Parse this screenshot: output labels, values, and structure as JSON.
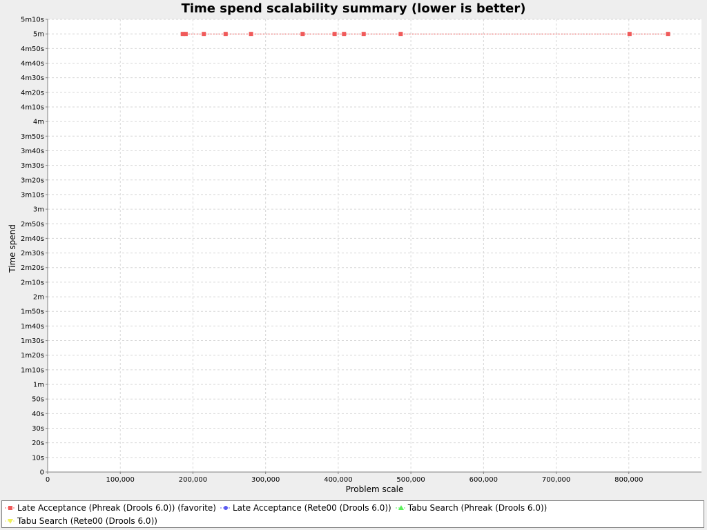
{
  "chart_data": {
    "type": "line",
    "title": "Time spend scalability summary (lower is better)",
    "xlabel": "Problem scale",
    "ylabel": "Time spend",
    "xlim": [
      0,
      900000
    ],
    "ylim": [
      0,
      310
    ],
    "x_ticks": [
      {
        "value": 0,
        "label": "0"
      },
      {
        "value": 100000,
        "label": "100,000"
      },
      {
        "value": 200000,
        "label": "200,000"
      },
      {
        "value": 300000,
        "label": "300,000"
      },
      {
        "value": 400000,
        "label": "400,000"
      },
      {
        "value": 500000,
        "label": "500,000"
      },
      {
        "value": 600000,
        "label": "600,000"
      },
      {
        "value": 700000,
        "label": "700,000"
      },
      {
        "value": 800000,
        "label": "800,000"
      }
    ],
    "y_ticks": [
      {
        "value": 0,
        "label": "0"
      },
      {
        "value": 10,
        "label": "10s"
      },
      {
        "value": 20,
        "label": "20s"
      },
      {
        "value": 30,
        "label": "30s"
      },
      {
        "value": 40,
        "label": "40s"
      },
      {
        "value": 50,
        "label": "50s"
      },
      {
        "value": 60,
        "label": "1m"
      },
      {
        "value": 70,
        "label": "1m10s"
      },
      {
        "value": 80,
        "label": "1m20s"
      },
      {
        "value": 90,
        "label": "1m30s"
      },
      {
        "value": 100,
        "label": "1m40s"
      },
      {
        "value": 110,
        "label": "1m50s"
      },
      {
        "value": 120,
        "label": "2m"
      },
      {
        "value": 130,
        "label": "2m10s"
      },
      {
        "value": 140,
        "label": "2m20s"
      },
      {
        "value": 150,
        "label": "2m30s"
      },
      {
        "value": 160,
        "label": "2m40s"
      },
      {
        "value": 170,
        "label": "2m50s"
      },
      {
        "value": 180,
        "label": "3m"
      },
      {
        "value": 190,
        "label": "3m10s"
      },
      {
        "value": 200,
        "label": "3m20s"
      },
      {
        "value": 210,
        "label": "3m30s"
      },
      {
        "value": 220,
        "label": "3m40s"
      },
      {
        "value": 230,
        "label": "3m50s"
      },
      {
        "value": 240,
        "label": "4m"
      },
      {
        "value": 250,
        "label": "4m10s"
      },
      {
        "value": 260,
        "label": "4m20s"
      },
      {
        "value": 270,
        "label": "4m30s"
      },
      {
        "value": 280,
        "label": "4m40s"
      },
      {
        "value": 290,
        "label": "4m50s"
      },
      {
        "value": 300,
        "label": "5m"
      },
      {
        "value": 310,
        "label": "5m10s"
      }
    ],
    "grid": true,
    "legend_position": "bottom",
    "series": [
      {
        "name": "Late Acceptance (Phreak (Drools 6.0)) (favorite)",
        "color": "#f05a5a",
        "marker": "square",
        "line": "dashed",
        "points": [
          {
            "x": 186000,
            "y": 300
          },
          {
            "x": 190000,
            "y": 300
          },
          {
            "x": 215000,
            "y": 300
          },
          {
            "x": 245000,
            "y": 300
          },
          {
            "x": 280000,
            "y": 300
          },
          {
            "x": 351000,
            "y": 300
          },
          {
            "x": 395000,
            "y": 300
          },
          {
            "x": 408000,
            "y": 300
          },
          {
            "x": 435000,
            "y": 300
          },
          {
            "x": 486000,
            "y": 300
          },
          {
            "x": 801000,
            "y": 300
          },
          {
            "x": 854000,
            "y": 300
          }
        ]
      },
      {
        "name": "Late Acceptance (Rete00 (Drools 6.0))",
        "color": "#5a5af0",
        "marker": "circle",
        "line": "dashed",
        "points": []
      },
      {
        "name": "Tabu Search (Phreak (Drools 6.0))",
        "color": "#5af05a",
        "marker": "triangle",
        "line": "dashed",
        "points": []
      },
      {
        "name": "Tabu Search (Rete00 (Drools 6.0))",
        "color": "#f0f05a",
        "marker": "triangle-down",
        "line": "dashed",
        "points": []
      }
    ]
  }
}
